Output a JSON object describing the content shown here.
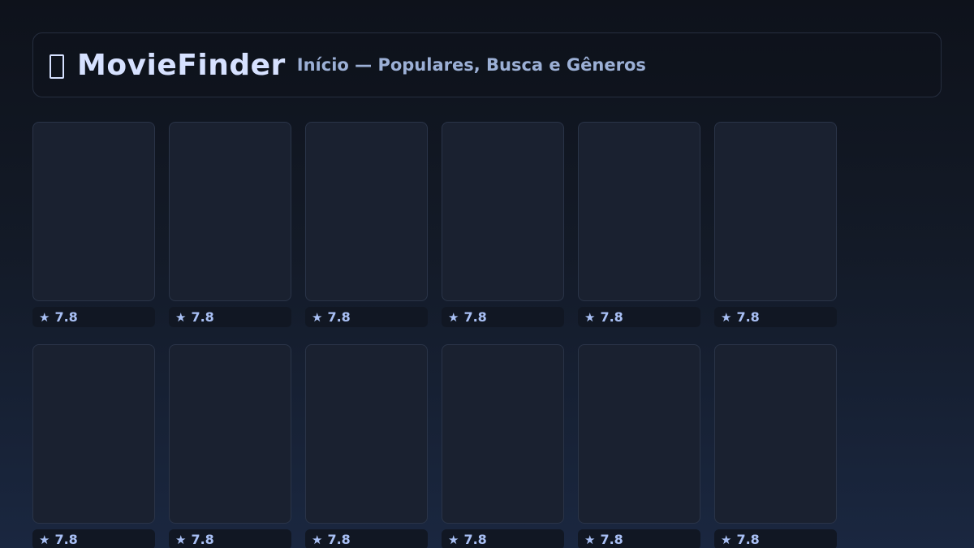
{
  "header": {
    "brand": "MovieFinder",
    "subtitle": "Início — Populares, Busca e Gêneros",
    "logo_icon": "missing-glyph-icon"
  },
  "movies": [
    {
      "rating": "7.8"
    },
    {
      "rating": "7.8"
    },
    {
      "rating": "7.8"
    },
    {
      "rating": "7.8"
    },
    {
      "rating": "7.8"
    },
    {
      "rating": "7.8"
    },
    {
      "rating": "7.8"
    },
    {
      "rating": "7.8"
    },
    {
      "rating": "7.8"
    },
    {
      "rating": "7.8"
    },
    {
      "rating": "7.8"
    },
    {
      "rating": "7.8"
    }
  ],
  "rating_icon": {
    "glyph": "★",
    "name": "star-icon"
  },
  "colors": {
    "accent": "#d6e1ff",
    "subtitle": "#9cb0d6",
    "rating_text": "#a9c0f5",
    "poster_bg": "#1a2130"
  }
}
